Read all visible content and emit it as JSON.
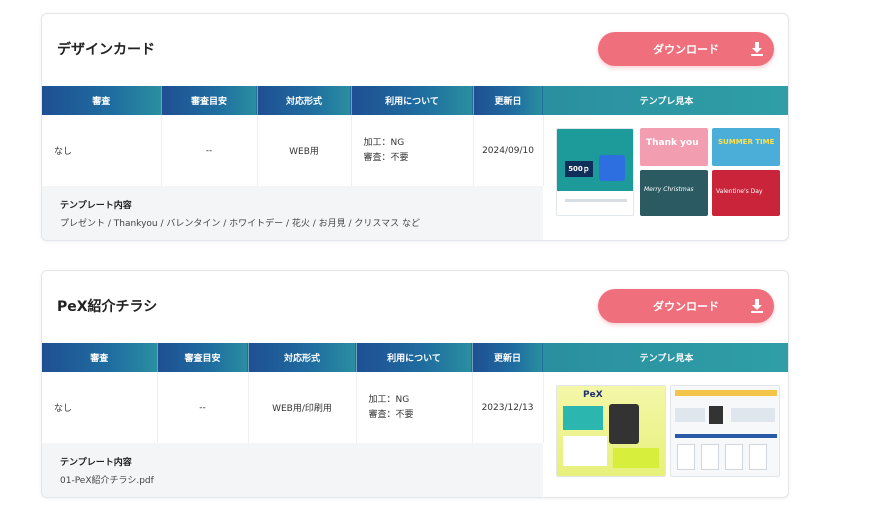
{
  "cards": [
    {
      "title": "デザインカード",
      "download_label": "ダウンロード",
      "headers": [
        "審査",
        "審査目安",
        "対応形式",
        "利用について",
        "更新日"
      ],
      "sample_header": "テンプレ見本",
      "row": {
        "review": "なし",
        "review_estimate": "--",
        "format": "WEB用",
        "usage_line1": "加工：NG",
        "usage_line2": "審査：不要",
        "updated": "2024/09/10"
      },
      "content_label": "テンプレート内容",
      "content_value": "プレゼント / Thankyou / バレンタイン / ホワイトデー / 花火 / お月見 / クリスマス など",
      "thumb_texts": [
        "500ｐ",
        "Thank you",
        "SUMMER TIME",
        "Merry Christmas",
        "Valentine's Day"
      ]
    },
    {
      "title": "PeX紹介チラシ",
      "download_label": "ダウンロード",
      "headers": [
        "審査",
        "審査目安",
        "対応形式",
        "利用について",
        "更新日"
      ],
      "sample_header": "テンプレ見本",
      "row": {
        "review": "なし",
        "review_estimate": "--",
        "format": "WEB用/印刷用",
        "usage_line1": "加工：NG",
        "usage_line2": "審査：不要",
        "updated": "2023/12/13"
      },
      "content_label": "テンプレート内容",
      "content_value": "01-PeX紹介チラシ.pdf",
      "thumb_texts": [
        "PeX"
      ]
    }
  ],
  "colors": {
    "accent_button": "#ef6f7c",
    "header_blue": "#1f4f93",
    "header_teal": "#2a8fa0",
    "content_bg": "#f3f5f7"
  },
  "icons": {
    "download": "download-icon"
  }
}
